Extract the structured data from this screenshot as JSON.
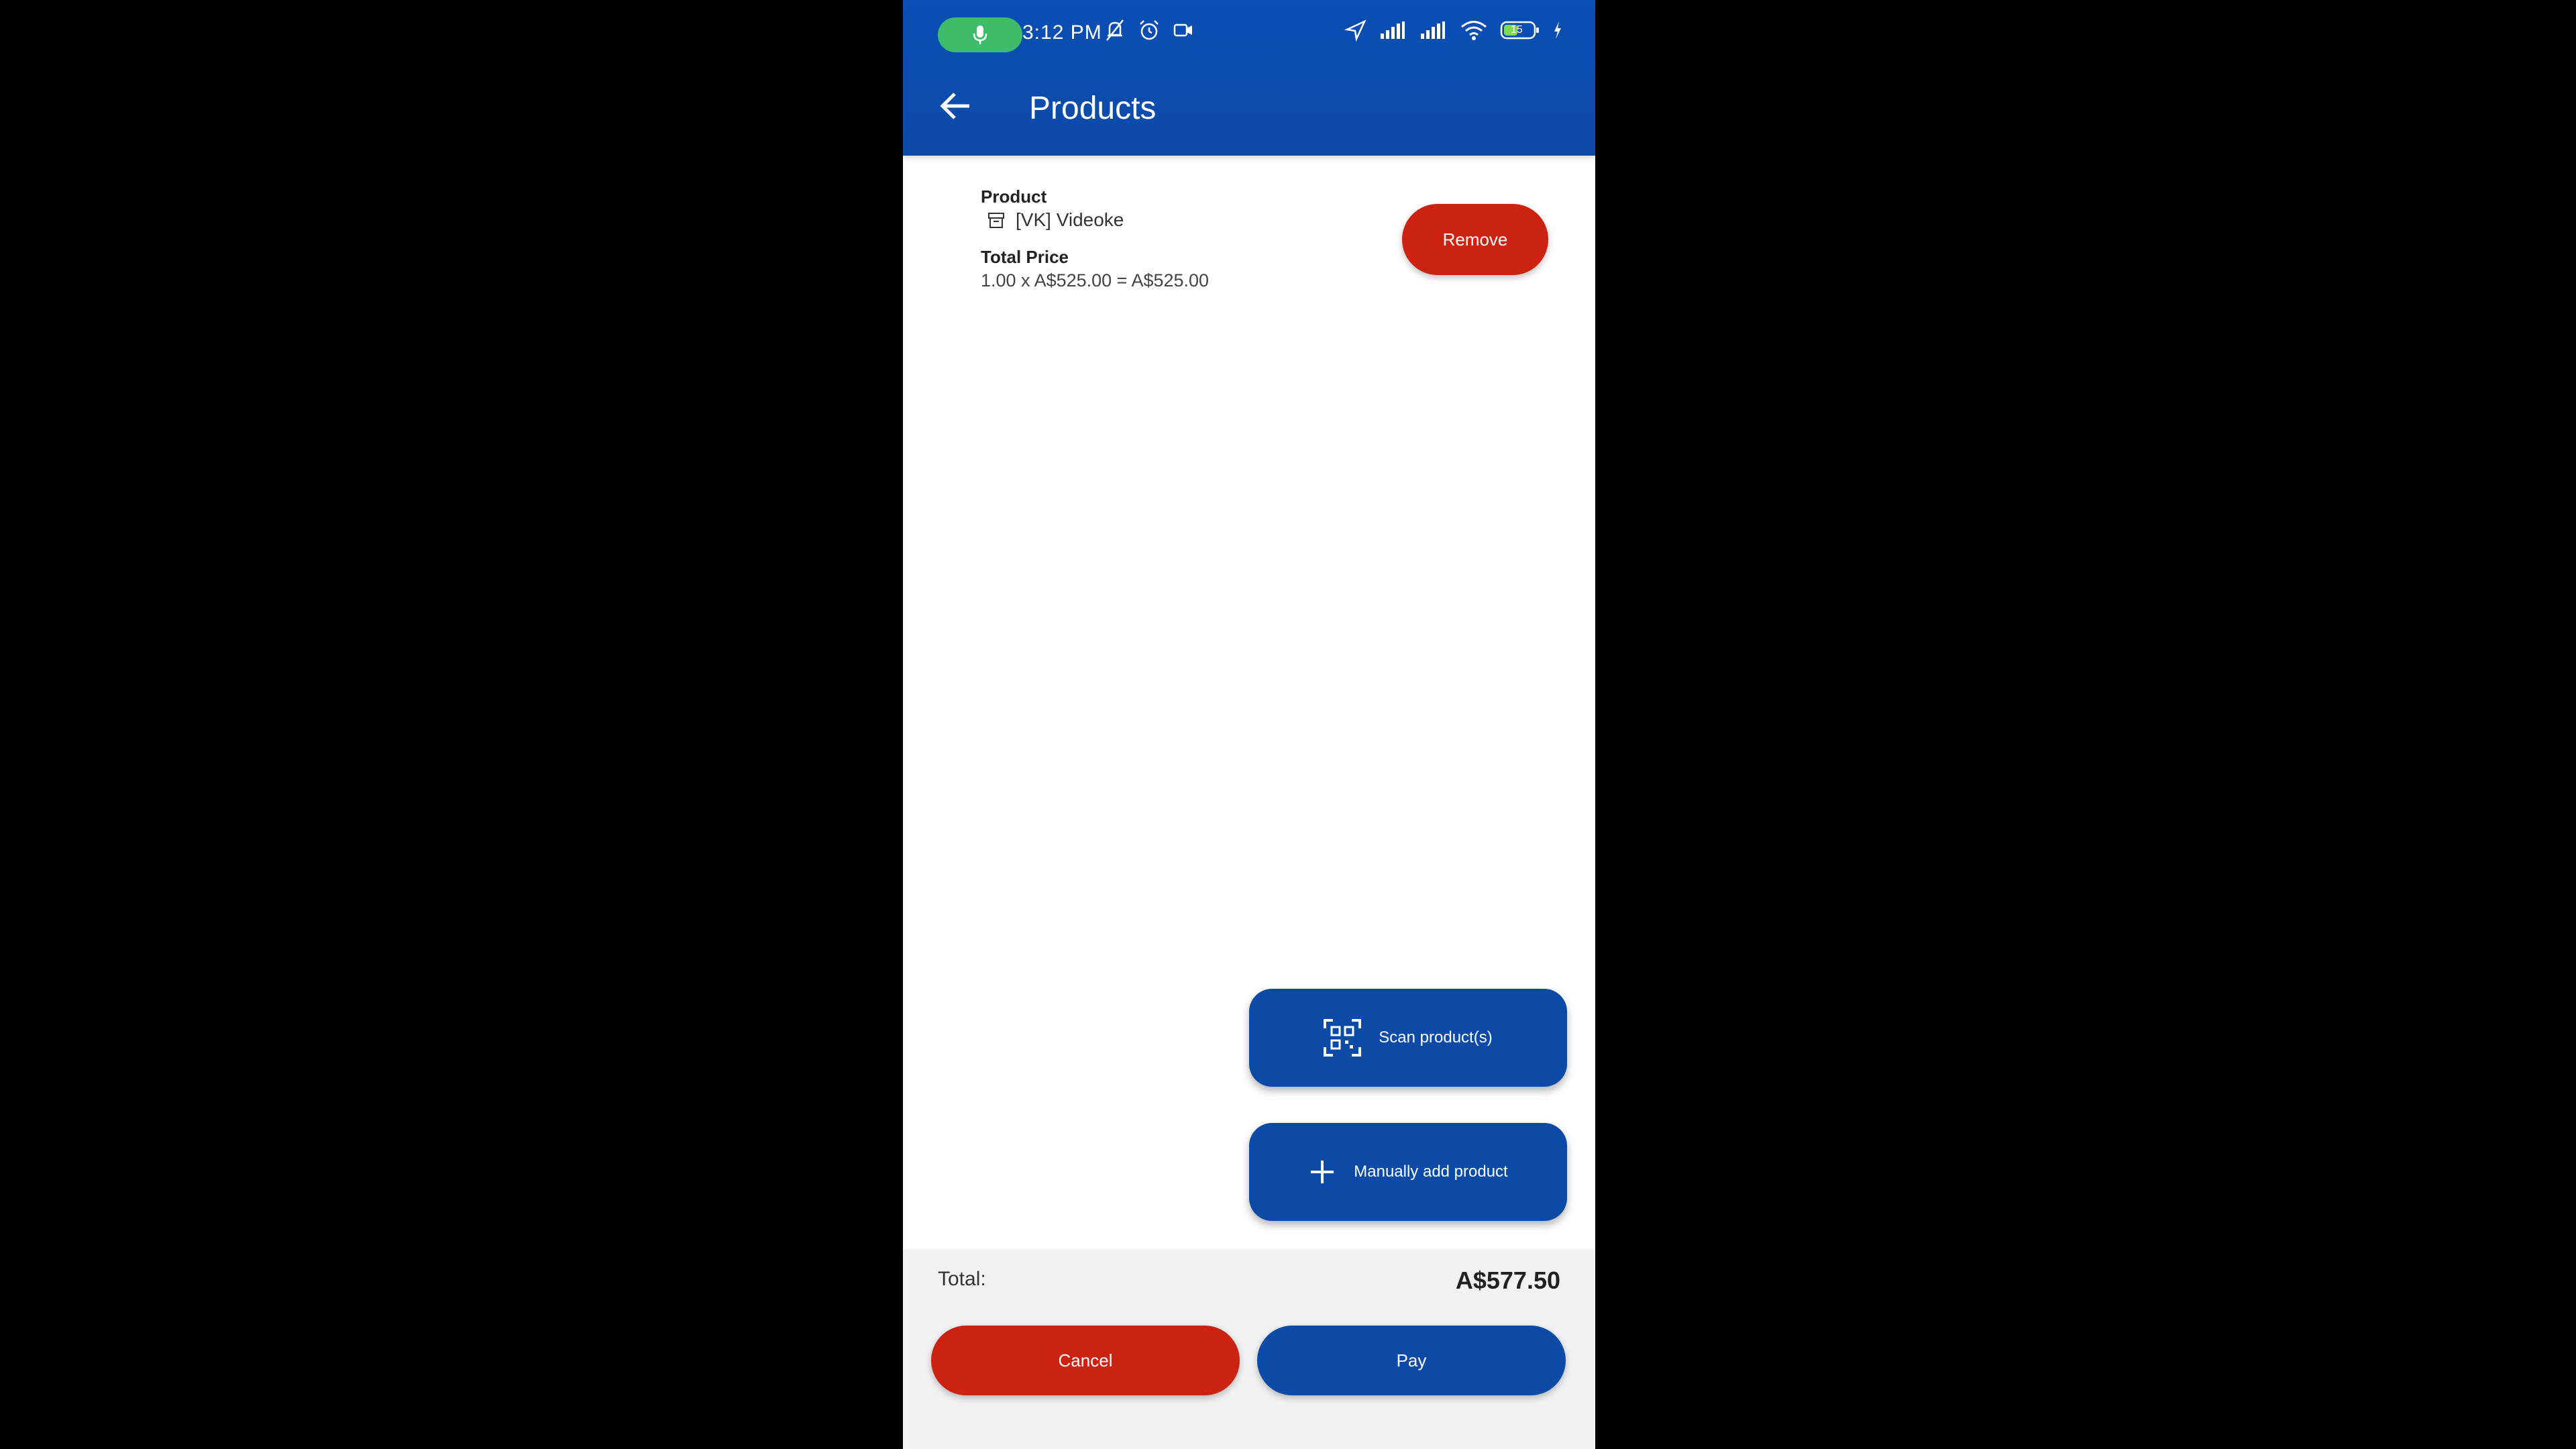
{
  "status_bar": {
    "time": "3:12  PM",
    "battery_level": "15"
  },
  "header": {
    "title": "Products"
  },
  "product": {
    "product_label": "Product",
    "name": "[VK] Videoke",
    "total_price_label": "Total Price",
    "total_price_value": "1.00 x A$525.00 = A$525.00",
    "remove_label": "Remove"
  },
  "actions": {
    "scan_label": "Scan product(s)",
    "manual_label": "Manually add product"
  },
  "footer": {
    "total_label": "Total:",
    "total_value": "A$577.50",
    "cancel_label": "Cancel",
    "pay_label": "Pay"
  },
  "colors": {
    "primary": "#0c4aa8",
    "danger": "#cc2211",
    "mic_pill": "#3dbd6a"
  }
}
